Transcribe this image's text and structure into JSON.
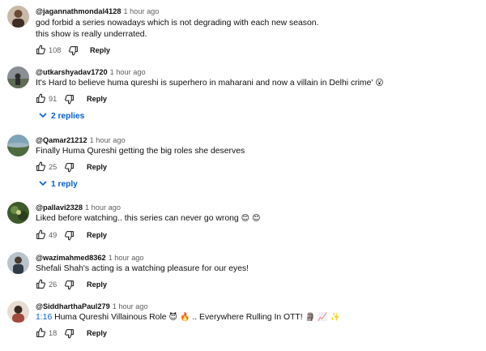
{
  "comments": [
    {
      "author": "@jagannathmondal4128",
      "time": "1 hour ago",
      "lines": [
        "god forbid a series nowadays which is not degrading with each new season.",
        "this show is really underrated."
      ],
      "likes": "108",
      "reply_label": "Reply"
    },
    {
      "author": "@utkarshyadav1720",
      "time": "1 hour ago",
      "text": "It's Hard to believe huma qureshi is superhero in maharani and now a villain in Delhi crime'",
      "emoji": "😮",
      "likes": "91",
      "reply_label": "Reply",
      "replies_label": "2 replies"
    },
    {
      "author": "@Qamar21212",
      "time": "1 hour ago",
      "text": "Finally Huma Qureshi getting the big roles she deserves",
      "likes": "25",
      "reply_label": "Reply",
      "replies_label": "1 reply"
    },
    {
      "author": "@pallavi2328",
      "time": "1 hour ago",
      "text": "Liked before watching.. this series can never go wrong",
      "emoji": "😊 😊",
      "likes": "49",
      "reply_label": "Reply"
    },
    {
      "author": "@wazimahmed8362",
      "time": "1 hour ago",
      "text": "Shefali Shah's acting is a watching pleasure for our eyes!",
      "likes": "26",
      "reply_label": "Reply"
    },
    {
      "author": "@SiddharthaPaul279",
      "time": "1 hour ago",
      "timestamp": "1:16",
      "text": "Huma Qureshi Villainous Role",
      "emoji1": "😈 🔥",
      "text2": ".. Everywhere Rulling In OTT!",
      "emoji2": "🗿 📈 ✨",
      "likes": "18",
      "reply_label": "Reply"
    }
  ],
  "icons": {
    "like": "thumb-up-icon",
    "dislike": "thumb-down-icon",
    "expand": "chevron-down-icon"
  },
  "colors": {
    "link": "#065fd4",
    "muted": "#606060",
    "text": "#0f0f0f"
  }
}
